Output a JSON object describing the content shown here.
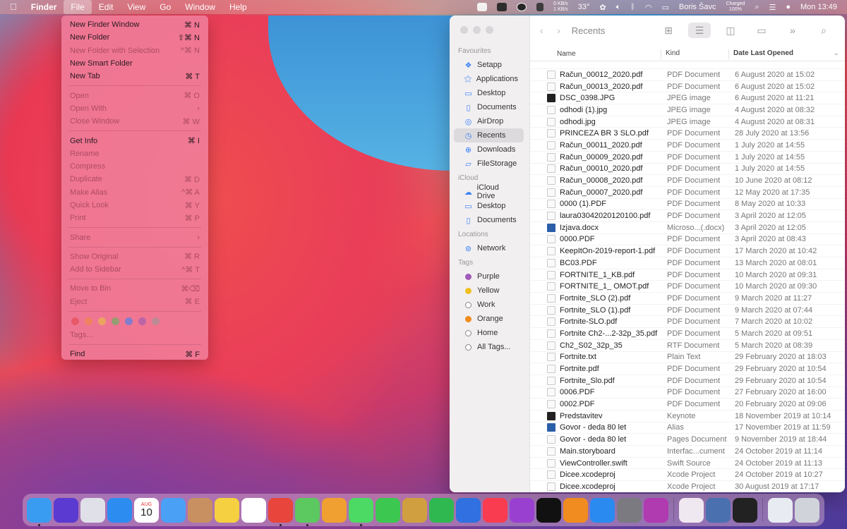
{
  "menubar": {
    "apple": "",
    "app": "Finder",
    "menus": [
      "File",
      "Edit",
      "View",
      "Go",
      "Window",
      "Help"
    ],
    "status": {
      "net_up": "0 KB/s",
      "net_down": "1 KB/s",
      "temp": "33°",
      "user": "Boris Šavc",
      "battery_line1": "Charged",
      "battery_line2": "100%",
      "clock": "Mon 13:49"
    }
  },
  "file_menu": {
    "items": [
      {
        "label": "New Finder Window",
        "shortcut": "⌘ N",
        "enabled": true
      },
      {
        "label": "New Folder",
        "shortcut": "⇧⌘ N",
        "enabled": true
      },
      {
        "label": "New Folder with Selection",
        "shortcut": "^⌘ N",
        "enabled": false
      },
      {
        "label": "New Smart Folder",
        "shortcut": "",
        "enabled": true
      },
      {
        "label": "New Tab",
        "shortcut": "⌘ T",
        "enabled": true
      },
      {
        "label": "Open",
        "shortcut": "⌘ O",
        "enabled": false
      },
      {
        "label": "Open With",
        "shortcut": "›",
        "enabled": false
      },
      {
        "label": "Close Window",
        "shortcut": "⌘ W",
        "enabled": false
      },
      {
        "label": "Get Info",
        "shortcut": "⌘ I",
        "enabled": true
      },
      {
        "label": "Rename",
        "shortcut": "",
        "enabled": false
      },
      {
        "label": "Compress",
        "shortcut": "",
        "enabled": false
      },
      {
        "label": "Duplicate",
        "shortcut": "⌘ D",
        "enabled": false
      },
      {
        "label": "Make Alias",
        "shortcut": "^⌘ A",
        "enabled": false
      },
      {
        "label": "Quick Look",
        "shortcut": "⌘ Y",
        "enabled": false
      },
      {
        "label": "Print",
        "shortcut": "⌘ P",
        "enabled": false
      },
      {
        "label": "Share",
        "shortcut": "›",
        "enabled": false
      },
      {
        "label": "Show Original",
        "shortcut": "⌘ R",
        "enabled": false
      },
      {
        "label": "Add to Sidebar",
        "shortcut": "^⌘ T",
        "enabled": false
      },
      {
        "label": "Move to Bin",
        "shortcut": "⌘⌫",
        "enabled": false
      },
      {
        "label": "Eject",
        "shortcut": "⌘ E",
        "enabled": false
      },
      {
        "label": "Tags...",
        "shortcut": "",
        "enabled": false
      },
      {
        "label": "Find",
        "shortcut": "⌘ F",
        "enabled": true
      }
    ],
    "tag_colors": [
      "#e5484d",
      "#f08c3a",
      "#e8c23a",
      "#5cb85c",
      "#3a82f6",
      "#9b59b6",
      "#9a9a9a"
    ]
  },
  "finder": {
    "title": "Recents",
    "sidebar": {
      "sections": [
        {
          "header": "Favourites",
          "items": [
            "Setapp",
            "Applications",
            "Desktop",
            "Documents",
            "AirDrop",
            "Recents",
            "Downloads",
            "FileStorage"
          ]
        },
        {
          "header": "iCloud",
          "items": [
            "iCloud Drive",
            "Desktop",
            "Documents"
          ]
        },
        {
          "header": "Locations",
          "items": [
            "Network"
          ]
        },
        {
          "header": "Tags",
          "items": [
            "Purple",
            "Yellow",
            "Work",
            "Orange",
            "Home",
            "All Tags..."
          ]
        }
      ],
      "selected": "Recents",
      "tag_colors": {
        "Purple": "#a05ab8",
        "Yellow": "#f0c020",
        "Work": "#ffffff",
        "Orange": "#f08c1a",
        "Home": "#ffffff",
        "All Tags...": "#ffffff"
      }
    },
    "columns": [
      "Name",
      "Kind",
      "Date Last Opened"
    ],
    "files": [
      {
        "name": "Račun_00012_2020.pdf",
        "kind": "PDF Document",
        "date": "6 August 2020 at 15:02",
        "icon": "pdf"
      },
      {
        "name": "Račun_00013_2020.pdf",
        "kind": "PDF Document",
        "date": "6 August 2020 at 15:02",
        "icon": "pdf"
      },
      {
        "name": "DSC_0398.JPG",
        "kind": "JPEG image",
        "date": "6 August 2020 at 11:21",
        "icon": "img-dark"
      },
      {
        "name": "odhodi (1).jpg",
        "kind": "JPEG image",
        "date": "4 August 2020 at 08:32",
        "icon": "img"
      },
      {
        "name": "odhodi.jpg",
        "kind": "JPEG image",
        "date": "4 August 2020 at 08:31",
        "icon": "img"
      },
      {
        "name": "PRINCEZA BR 3 SLO.pdf",
        "kind": "PDF Document",
        "date": "28 July 2020 at 13:56",
        "icon": "pdf"
      },
      {
        "name": "Račun_00011_2020.pdf",
        "kind": "PDF Document",
        "date": "1 July 2020 at 14:55",
        "icon": "pdf"
      },
      {
        "name": "Račun_00009_2020.pdf",
        "kind": "PDF Document",
        "date": "1 July 2020 at 14:55",
        "icon": "pdf"
      },
      {
        "name": "Račun_00010_2020.pdf",
        "kind": "PDF Document",
        "date": "1 July 2020 at 14:55",
        "icon": "pdf"
      },
      {
        "name": "Račun_00008_2020.pdf",
        "kind": "PDF Document",
        "date": "10 June 2020 at 08:12",
        "icon": "pdf"
      },
      {
        "name": "Račun_00007_2020.pdf",
        "kind": "PDF Document",
        "date": "12 May 2020 at 17:35",
        "icon": "pdf"
      },
      {
        "name": "0000 (1).PDF",
        "kind": "PDF Document",
        "date": "8 May 2020 at 10:33",
        "icon": "pdf"
      },
      {
        "name": "laura03042020120100.pdf",
        "kind": "PDF Document",
        "date": "3 April 2020 at 12:05",
        "icon": "pdf"
      },
      {
        "name": "Izjava.docx",
        "kind": "Microso...(.docx)",
        "date": "3 April 2020 at 12:05",
        "icon": "word"
      },
      {
        "name": "0000.PDF",
        "kind": "PDF Document",
        "date": "3 April 2020 at 08:43",
        "icon": "pdf"
      },
      {
        "name": "KeepItOn-2019-report-1.pdf",
        "kind": "PDF Document",
        "date": "17 March 2020 at 10:42",
        "icon": "pdf"
      },
      {
        "name": "BC03.PDF",
        "kind": "PDF Document",
        "date": "13 March 2020 at 08:01",
        "icon": "pdf"
      },
      {
        "name": "FORTNITE_1_KB.pdf",
        "kind": "PDF Document",
        "date": "10 March 2020 at 09:31",
        "icon": "pdf"
      },
      {
        "name": "FORTNITE_1_ OMOT.pdf",
        "kind": "PDF Document",
        "date": "10 March 2020 at 09:30",
        "icon": "pdf"
      },
      {
        "name": "Fortnite_SLO (2).pdf",
        "kind": "PDF Document",
        "date": "9 March 2020 at 11:27",
        "icon": "pdf"
      },
      {
        "name": "Fortnite_SLO (1).pdf",
        "kind": "PDF Document",
        "date": "9 March 2020 at 07:44",
        "icon": "pdf"
      },
      {
        "name": "Fortnite-SLO.pdf",
        "kind": "PDF Document",
        "date": "7 March 2020 at 10:02",
        "icon": "pdf"
      },
      {
        "name": "Fortnite Ch2-...2-32p_35.pdf",
        "kind": "PDF Document",
        "date": "5 March 2020 at 09:51",
        "icon": "pdf"
      },
      {
        "name": "Ch2_S02_32p_35",
        "kind": "RTF Document",
        "date": "5 March 2020 at 08:39",
        "icon": "rtf"
      },
      {
        "name": "Fortnite.txt",
        "kind": "Plain Text",
        "date": "29 February 2020 at 18:03",
        "icon": "txt"
      },
      {
        "name": "Fortnite.pdf",
        "kind": "PDF Document",
        "date": "29 February 2020 at 10:54",
        "icon": "pdf"
      },
      {
        "name": "Fortnite_Slo.pdf",
        "kind": "PDF Document",
        "date": "29 February 2020 at 10:54",
        "icon": "pdf"
      },
      {
        "name": "0006.PDF",
        "kind": "PDF Document",
        "date": "27 February 2020 at 16:00",
        "icon": "pdf"
      },
      {
        "name": "0002.PDF",
        "kind": "PDF Document",
        "date": "20 February 2020 at 09:06",
        "icon": "pdf"
      },
      {
        "name": "Predstavitev",
        "kind": "Keynote",
        "date": "18 November 2019 at 10:14",
        "icon": "img-dark"
      },
      {
        "name": "Govor - deda 80 let",
        "kind": "Alias",
        "date": "17 November 2019 at 11:59",
        "icon": "word"
      },
      {
        "name": "Govor - deda 80 let",
        "kind": "Pages Document",
        "date": "9 November 2019 at 18:44",
        "icon": "txt"
      },
      {
        "name": "Main.storyboard",
        "kind": "Interfac...cument",
        "date": "24 October 2019 at 11:14",
        "icon": "txt"
      },
      {
        "name": "ViewController.swift",
        "kind": "Swift Source",
        "date": "24 October 2019 at 11:13",
        "icon": "txt"
      },
      {
        "name": "Dicee.xcodeproj",
        "kind": "Xcode Project",
        "date": "24 October 2019 at 10:27",
        "icon": "txt"
      },
      {
        "name": "Dicee.xcodeproj",
        "kind": "Xcode Project",
        "date": "30 August 2019 at 17:17",
        "icon": "txt"
      }
    ]
  },
  "dock": {
    "calendar_month": "AUG",
    "calendar_day": "10",
    "apps": [
      {
        "name": "Finder",
        "color": "#3a9cf0",
        "running": true
      },
      {
        "name": "Siri",
        "color": "#5a3ad0",
        "running": false
      },
      {
        "name": "Launchpad",
        "color": "#e0e0e8",
        "running": false
      },
      {
        "name": "Safari",
        "color": "#2d8cf0",
        "running": false
      },
      {
        "name": "Calendar",
        "color": "#ffffff",
        "running": false
      },
      {
        "name": "Mail",
        "color": "#4aa0f5",
        "running": false
      },
      {
        "name": "Contacts",
        "color": "#c89060",
        "running": false
      },
      {
        "name": "Notes",
        "color": "#f5d040",
        "running": false
      },
      {
        "name": "Reminders",
        "color": "#ffffff",
        "running": false
      },
      {
        "name": "Chrome",
        "color": "#e8453c",
        "running": true
      },
      {
        "name": "Maps",
        "color": "#5cc860",
        "running": true
      },
      {
        "name": "Photos",
        "color": "#f0a030",
        "running": false
      },
      {
        "name": "Messages",
        "color": "#4cd964",
        "running": true
      },
      {
        "name": "FaceTime",
        "color": "#3cc850",
        "running": false
      },
      {
        "name": "Preview",
        "color": "#d0a040",
        "running": false
      },
      {
        "name": "Numbers",
        "color": "#30b850",
        "running": false
      },
      {
        "name": "Keynote",
        "color": "#3070e0",
        "running": false
      },
      {
        "name": "Music",
        "color": "#fa3c50",
        "running": false
      },
      {
        "name": "Podcasts",
        "color": "#9a40d0",
        "running": false
      },
      {
        "name": "TV",
        "color": "#111111",
        "running": false
      },
      {
        "name": "Books",
        "color": "#f08c20",
        "running": false
      },
      {
        "name": "App Store",
        "color": "#2a8af0",
        "running": false
      },
      {
        "name": "System Preferences",
        "color": "#7a7a80",
        "running": false
      },
      {
        "name": "Feedback",
        "color": "#b03ab0",
        "running": false
      },
      {
        "name": "Setapp",
        "color": "#f0e8f0",
        "running": false
      },
      {
        "name": "Migration",
        "color": "#4a70b0",
        "running": false
      },
      {
        "name": "Voice Memos",
        "color": "#222222",
        "running": false
      },
      {
        "name": "Documents Folder",
        "color": "#e8ecf2",
        "running": false
      },
      {
        "name": "Bin",
        "color": "#d0d4da",
        "running": false
      }
    ]
  }
}
